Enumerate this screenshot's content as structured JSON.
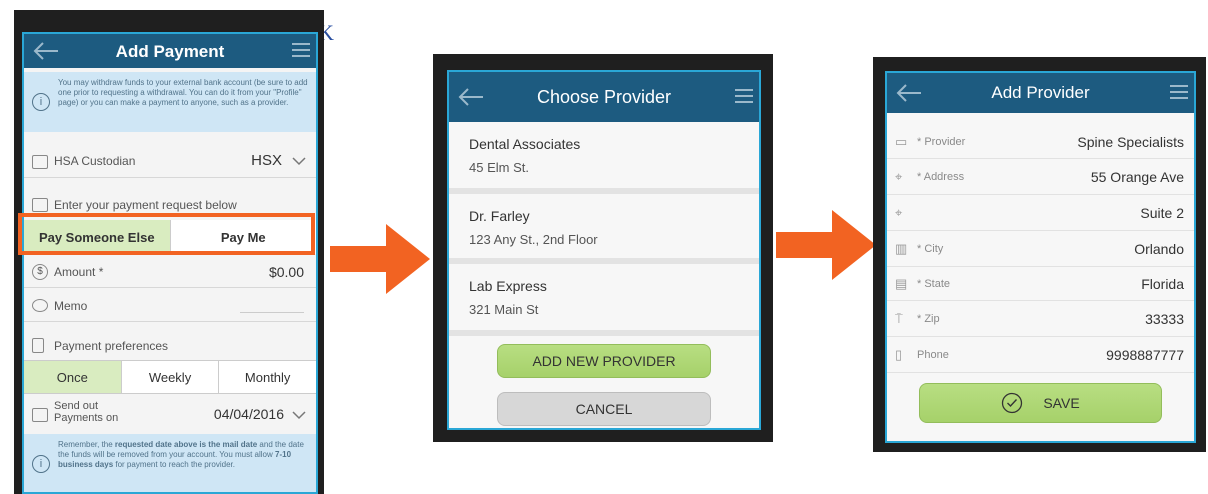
{
  "stray_text": "K",
  "screen1": {
    "title": "Add Payment",
    "info_text": "You may withdraw funds to your external bank account (be sure to add one prior to requesting a withdrawal. You can do it from your \"Profile\" page) or you can make a payment to anyone, such as a provider.",
    "custodian_label": "HSA Custodian",
    "custodian_value": "HSX",
    "request_label": "Enter your payment request below",
    "tab_pay_someone": "Pay Someone Else",
    "tab_pay_me": "Pay Me",
    "amount_label": "Amount *",
    "amount_value": "$0.00",
    "memo_label": "Memo",
    "prefs_label": "Payment preferences",
    "freq_once": "Once",
    "freq_weekly": "Weekly",
    "freq_monthly": "Monthly",
    "send_label": "Send out Payments on",
    "send_date": "04/04/2016",
    "reminder_pre": "Remember, the ",
    "reminder_b1": "requested date above is the mail date",
    "reminder_mid": " and the date the funds will be removed from your account. You must allow ",
    "reminder_b2": "7-10 business days",
    "reminder_post": " for payment to reach the provider."
  },
  "screen2": {
    "title": "Choose Provider",
    "providers": [
      {
        "name": "Dental Associates",
        "address": "45 Elm St."
      },
      {
        "name": "Dr. Farley",
        "address": "123 Any St., 2nd Floor"
      },
      {
        "name": "Lab Express",
        "address": "321 Main St"
      }
    ],
    "add_button": "ADD NEW PROVIDER",
    "cancel_button": "CANCEL"
  },
  "screen3": {
    "title": "Add Provider",
    "fields": [
      {
        "label": "* Provider",
        "value": "Spine Specialists",
        "icon": "card-icon"
      },
      {
        "label": "* Address",
        "value": "55 Orange Ave",
        "icon": "location-pin-icon"
      },
      {
        "label": "",
        "value": "Suite 2",
        "icon": "location-pin-icon"
      },
      {
        "label": "* City",
        "value": "Orlando",
        "icon": "city-icon"
      },
      {
        "label": "* State",
        "value": "Florida",
        "icon": "id-card-icon"
      },
      {
        "label": "* Zip",
        "value": "33333",
        "icon": "signpost-icon"
      },
      {
        "label": "Phone",
        "value": "9998887777",
        "icon": "phone-icon"
      }
    ],
    "save_button": "SAVE"
  },
  "colors": {
    "header": "#1d5b80",
    "highlight_box": "#f26322",
    "arrow": "#f26322",
    "active_segment": "#d9ecc0",
    "button_green": "#a6d16a"
  }
}
